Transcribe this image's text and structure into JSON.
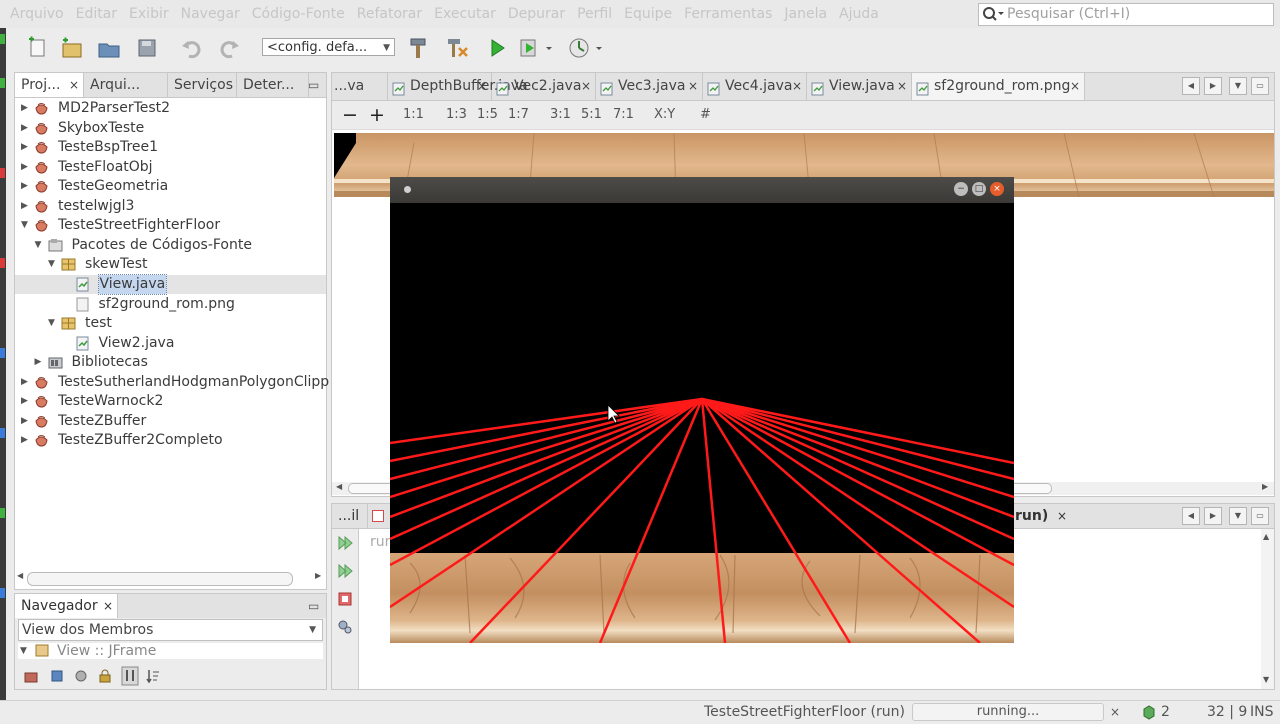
{
  "menubar": {
    "items": [
      "Arquivo",
      "Editar",
      "Exibir",
      "Navegar",
      "Código-Fonte",
      "Refatorar",
      "Executar",
      "Depurar",
      "Perfil",
      "Equipe",
      "Ferramentas",
      "Janela",
      "Ajuda"
    ],
    "search_placeholder": "Pesquisar (Ctrl+I)"
  },
  "toolbar": {
    "config": "<config. defa..."
  },
  "project_panel": {
    "tabs": [
      {
        "label": "Proj...",
        "close": "×"
      },
      {
        "label": "Arqui..."
      },
      {
        "label": "Serviços"
      },
      {
        "label": "Deter..."
      }
    ],
    "minimize": "▭",
    "tree": [
      {
        "label": "MD2ParserTest2",
        "level": 0,
        "kind": "project",
        "expanded": false
      },
      {
        "label": "SkyboxTeste",
        "level": 0,
        "kind": "project",
        "expanded": false
      },
      {
        "label": "TesteBspTree1",
        "level": 0,
        "kind": "project",
        "expanded": false
      },
      {
        "label": "TesteFloatObj",
        "level": 0,
        "kind": "project",
        "expanded": false
      },
      {
        "label": "TesteGeometria",
        "level": 0,
        "kind": "project",
        "expanded": false
      },
      {
        "label": "testelwjgl3",
        "level": 0,
        "kind": "project",
        "expanded": false
      },
      {
        "label": "TesteStreetFighterFloor",
        "level": 0,
        "kind": "project",
        "expanded": true
      },
      {
        "label": "Pacotes de Códigos-Fonte",
        "level": 1,
        "kind": "sources",
        "expanded": true
      },
      {
        "label": "skewTest",
        "level": 2,
        "kind": "package",
        "expanded": true
      },
      {
        "label": "View.java",
        "level": 3,
        "kind": "java",
        "selected": true
      },
      {
        "label": "sf2ground_rom.png",
        "level": 3,
        "kind": "image"
      },
      {
        "label": "test",
        "level": 2,
        "kind": "package",
        "expanded": true
      },
      {
        "label": "View2.java",
        "level": 3,
        "kind": "java"
      },
      {
        "label": "Bibliotecas",
        "level": 1,
        "kind": "library",
        "expanded": false
      },
      {
        "label": "TesteSutherlandHodgmanPolygonClipp",
        "level": 0,
        "kind": "project",
        "expanded": false
      },
      {
        "label": "TesteWarnock2",
        "level": 0,
        "kind": "project",
        "expanded": false
      },
      {
        "label": "TesteZBuffer",
        "level": 0,
        "kind": "project",
        "expanded": false
      },
      {
        "label": "TesteZBuffer2Completo",
        "level": 0,
        "kind": "project",
        "expanded": false
      }
    ]
  },
  "navigator": {
    "tab": "Navegador",
    "close": "×",
    "select": "View dos Membros",
    "item": "View :: JFrame"
  },
  "editor": {
    "tabs": [
      {
        "label": "...va",
        "close": ""
      },
      {
        "label": "DepthBuffer.java",
        "close": "×"
      },
      {
        "label": "Vec2.java",
        "close": "×"
      },
      {
        "label": "Vec3.java",
        "close": "×"
      },
      {
        "label": "Vec4.java",
        "close": "×"
      },
      {
        "label": "View.java",
        "close": "×"
      },
      {
        "label": "sf2ground_rom.png",
        "close": "×",
        "active": true
      }
    ],
    "image_toolbar": [
      "−",
      "+",
      "1:1",
      "1:3",
      "1:5",
      "1:7",
      "3:1",
      "5:1",
      "7:1",
      "X:Y",
      "#"
    ]
  },
  "output": {
    "tabs": [
      {
        "label": "...il"
      },
      {
        "label": "run)"
      }
    ],
    "close": "×",
    "text": "run"
  },
  "status": {
    "project_run": "TesteStreetFighterFloor (run)",
    "progress": "running...",
    "close": "×",
    "count": "2",
    "position": "32 | 9",
    "mode": "INS"
  },
  "colors": {
    "ray": "#ff1a1a",
    "wood": "#d9a878"
  }
}
